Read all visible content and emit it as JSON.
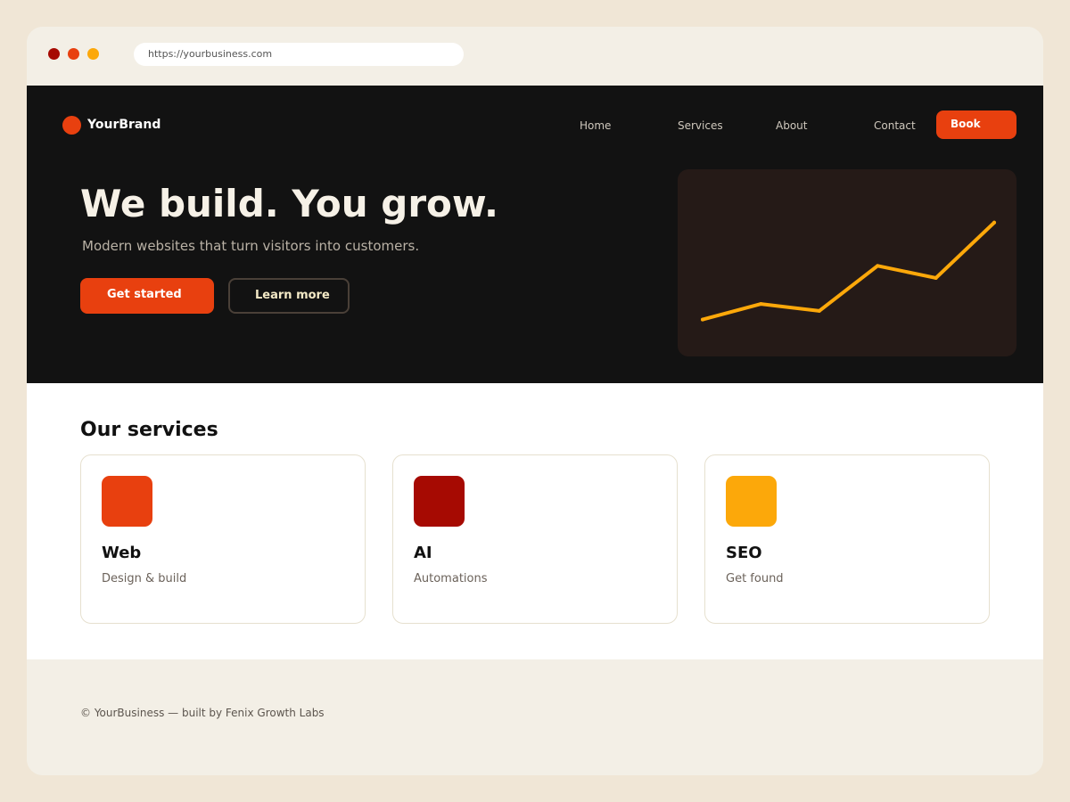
{
  "browser": {
    "url": "https://yourbusiness.com",
    "dots": [
      "#a60a02",
      "#e8400f",
      "#fca80a"
    ]
  },
  "colors": {
    "accent": "#e8400f",
    "chart_line": "#fca80a"
  },
  "header": {
    "brand": "YourBrand",
    "nav": [
      "Home",
      "Services",
      "About",
      "Contact"
    ],
    "book_label": "Book"
  },
  "hero": {
    "title": "We build. You grow.",
    "subtitle": "Modern websites that turn visitors into customers.",
    "primary_cta": "Get started",
    "secondary_cta": "Learn more"
  },
  "chart_data": {
    "type": "line",
    "title": "",
    "xlabel": "",
    "ylabel": "",
    "grid": false,
    "x": [
      1,
      2,
      3,
      4,
      5,
      6
    ],
    "series": [
      {
        "values": [
          1.0,
          1.9,
          1.5,
          4.1,
          3.4,
          6.6
        ],
        "color": "#fca80a"
      }
    ],
    "xlim": [
      1,
      6
    ],
    "ylim": [
      0,
      7
    ]
  },
  "services": {
    "title": "Our services",
    "cards": [
      {
        "title": "Web",
        "subtitle": "Design & build",
        "color": "#e8400f"
      },
      {
        "title": "AI",
        "subtitle": "Automations",
        "color": "#a60a02"
      },
      {
        "title": "SEO",
        "subtitle": "Get found",
        "color": "#fca80a"
      }
    ]
  },
  "footer": {
    "text": "© YourBusiness — built by Fenix Growth Labs"
  }
}
